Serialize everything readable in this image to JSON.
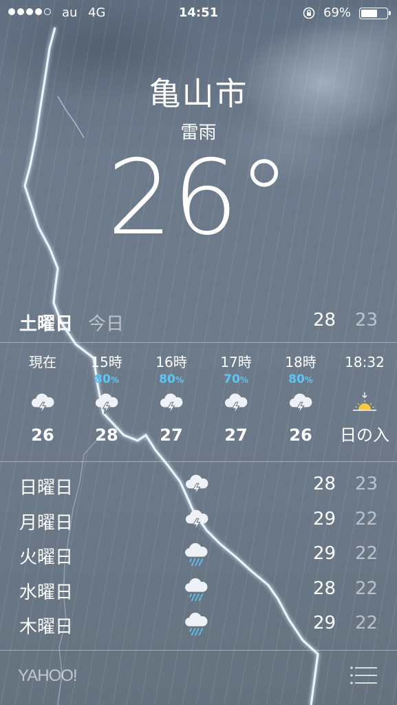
{
  "status_bar": {
    "signal_dots_filled": 4,
    "signal_dots_total": 5,
    "carrier": "au",
    "network": "4G",
    "time": "14:51",
    "battery_percent": "69%",
    "battery_level": 0.69
  },
  "header": {
    "city": "亀山市",
    "condition": "雷雨",
    "temperature": "26",
    "degree_symbol": "°"
  },
  "today": {
    "day": "土曜日",
    "label": "今日",
    "high": "28",
    "low": "23"
  },
  "hourly": [
    {
      "time": "現在",
      "pop": "",
      "icon": "thunderstorm-icon",
      "temp": "26"
    },
    {
      "time": "15時",
      "pop": "80",
      "icon": "thunderstorm-icon",
      "temp": "28"
    },
    {
      "time": "16時",
      "pop": "80",
      "icon": "thunderstorm-icon",
      "temp": "27"
    },
    {
      "time": "17時",
      "pop": "70",
      "icon": "thunderstorm-icon",
      "temp": "27"
    },
    {
      "time": "18時",
      "pop": "80",
      "icon": "thunderstorm-icon",
      "temp": "26"
    },
    {
      "time": "18:32",
      "pop": "",
      "icon": "sunset-icon",
      "temp": "日の入"
    }
  ],
  "pop_unit": "%",
  "daily": [
    {
      "day": "日曜日",
      "icon": "thunderstorm-icon",
      "high": "28",
      "low": "23"
    },
    {
      "day": "月曜日",
      "icon": "thunderstorm-icon",
      "high": "29",
      "low": "22"
    },
    {
      "day": "火曜日",
      "icon": "rain-icon",
      "high": "29",
      "low": "22"
    },
    {
      "day": "水曜日",
      "icon": "rain-icon",
      "high": "28",
      "low": "22"
    },
    {
      "day": "木曜日",
      "icon": "rain-icon",
      "high": "29",
      "low": "22"
    }
  ],
  "footer": {
    "logo": "YAHOO!",
    "menu_icon": "list-icon"
  },
  "colors": {
    "precip": "#5cc6f7",
    "sun": "#f7c948"
  }
}
